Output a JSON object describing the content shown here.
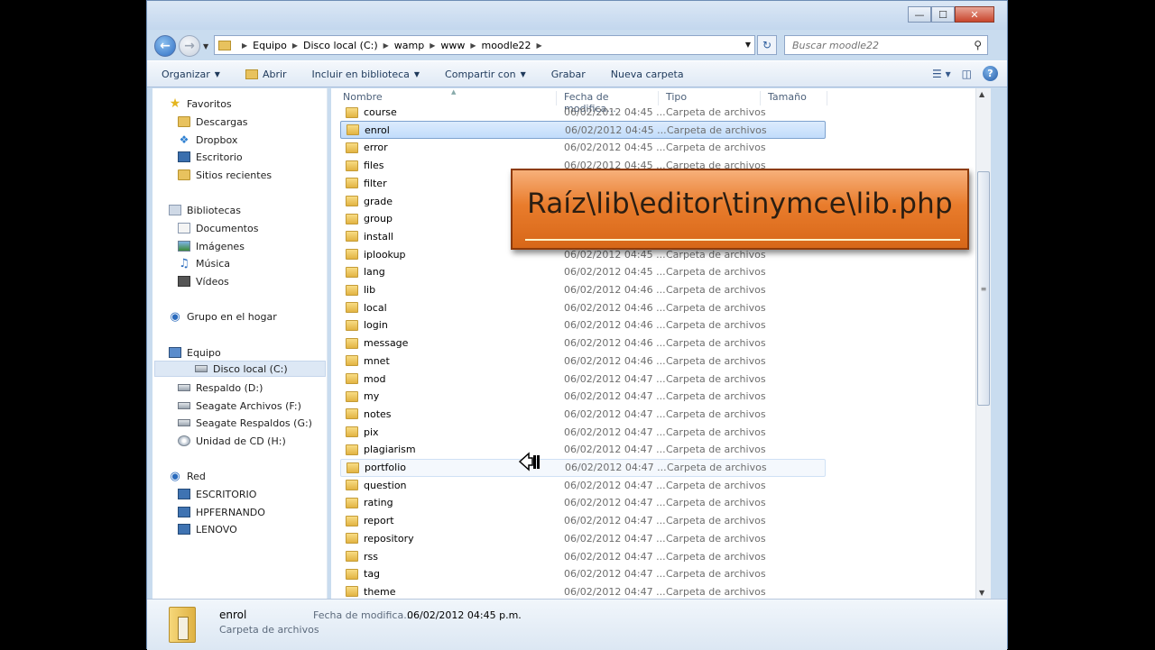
{
  "window": {
    "minimize": "—",
    "maximize": "☐",
    "close": "✕"
  },
  "address": {
    "crumbs": [
      "Equipo",
      "Disco local (C:)",
      "wamp",
      "www",
      "moodle22"
    ]
  },
  "search": {
    "placeholder": "Buscar moodle22"
  },
  "toolbar": {
    "organize": "Organizar",
    "open": "Abrir",
    "include_library": "Incluir en biblioteca",
    "share": "Compartir con",
    "burn": "Grabar",
    "new_folder": "Nueva carpeta",
    "help": "?"
  },
  "nav": {
    "favorites": "Favoritos",
    "fav_items": [
      "Descargas",
      "Dropbox",
      "Escritorio",
      "Sitios recientes"
    ],
    "libraries": "Bibliotecas",
    "lib_items": [
      "Documentos",
      "Imágenes",
      "Música",
      "Vídeos"
    ],
    "homegroup": "Grupo en el hogar",
    "computer": "Equipo",
    "drives": [
      "Disco local (C:)",
      "Respaldo (D:)",
      "Seagate Archivos (F:)",
      "Seagate Respaldos (G:)",
      "Unidad de CD (H:)"
    ],
    "network": "Red",
    "net_items": [
      "ESCRITORIO",
      "HPFERNANDO",
      "LENOVO"
    ]
  },
  "columns": {
    "name": "Nombre",
    "date": "Fecha de modifica...",
    "type": "Tipo",
    "size": "Tamaño"
  },
  "files": [
    {
      "name": "course",
      "date": "06/02/2012 04:45 ...",
      "type": "Carpeta de archivos"
    },
    {
      "name": "enrol",
      "date": "06/02/2012 04:45 ...",
      "type": "Carpeta de archivos"
    },
    {
      "name": "error",
      "date": "06/02/2012 04:45 ...",
      "type": "Carpeta de archivos"
    },
    {
      "name": "files",
      "date": "06/02/2012 04:45 ...",
      "type": "Carpeta de archivos"
    },
    {
      "name": "filter",
      "date": "",
      "type": ""
    },
    {
      "name": "grade",
      "date": "",
      "type": ""
    },
    {
      "name": "group",
      "date": "",
      "type": ""
    },
    {
      "name": "install",
      "date": "",
      "type": ""
    },
    {
      "name": "iplookup",
      "date": "06/02/2012 04:45 ...",
      "type": "Carpeta de archivos"
    },
    {
      "name": "lang",
      "date": "06/02/2012 04:45 ...",
      "type": "Carpeta de archivos"
    },
    {
      "name": "lib",
      "date": "06/02/2012 04:46 ...",
      "type": "Carpeta de archivos"
    },
    {
      "name": "local",
      "date": "06/02/2012 04:46 ...",
      "type": "Carpeta de archivos"
    },
    {
      "name": "login",
      "date": "06/02/2012 04:46 ...",
      "type": "Carpeta de archivos"
    },
    {
      "name": "message",
      "date": "06/02/2012 04:46 ...",
      "type": "Carpeta de archivos"
    },
    {
      "name": "mnet",
      "date": "06/02/2012 04:46 ...",
      "type": "Carpeta de archivos"
    },
    {
      "name": "mod",
      "date": "06/02/2012 04:47 ...",
      "type": "Carpeta de archivos"
    },
    {
      "name": "my",
      "date": "06/02/2012 04:47 ...",
      "type": "Carpeta de archivos"
    },
    {
      "name": "notes",
      "date": "06/02/2012 04:47 ...",
      "type": "Carpeta de archivos"
    },
    {
      "name": "pix",
      "date": "06/02/2012 04:47 ...",
      "type": "Carpeta de archivos"
    },
    {
      "name": "plagiarism",
      "date": "06/02/2012 04:47 ...",
      "type": "Carpeta de archivos"
    },
    {
      "name": "portfolio",
      "date": "06/02/2012 04:47 ...",
      "type": "Carpeta de archivos"
    },
    {
      "name": "question",
      "date": "06/02/2012 04:47 ...",
      "type": "Carpeta de archivos"
    },
    {
      "name": "rating",
      "date": "06/02/2012 04:47 ...",
      "type": "Carpeta de archivos"
    },
    {
      "name": "report",
      "date": "06/02/2012 04:47 ...",
      "type": "Carpeta de archivos"
    },
    {
      "name": "repository",
      "date": "06/02/2012 04:47 ...",
      "type": "Carpeta de archivos"
    },
    {
      "name": "rss",
      "date": "06/02/2012 04:47 ...",
      "type": "Carpeta de archivos"
    },
    {
      "name": "tag",
      "date": "06/02/2012 04:47 ...",
      "type": "Carpeta de archivos"
    },
    {
      "name": "theme",
      "date": "06/02/2012 04:47 ...",
      "type": "Carpeta de archivos"
    }
  ],
  "selected_file": "enrol",
  "hovered_file": "portfolio",
  "details": {
    "name": "enrol",
    "type": "Carpeta de archivos",
    "date_label": "Fecha de modifica...",
    "date": "06/02/2012 04:45 p.m."
  },
  "banner": {
    "text": "Raíz\\lib\\editor\\tinymce\\lib.php"
  }
}
